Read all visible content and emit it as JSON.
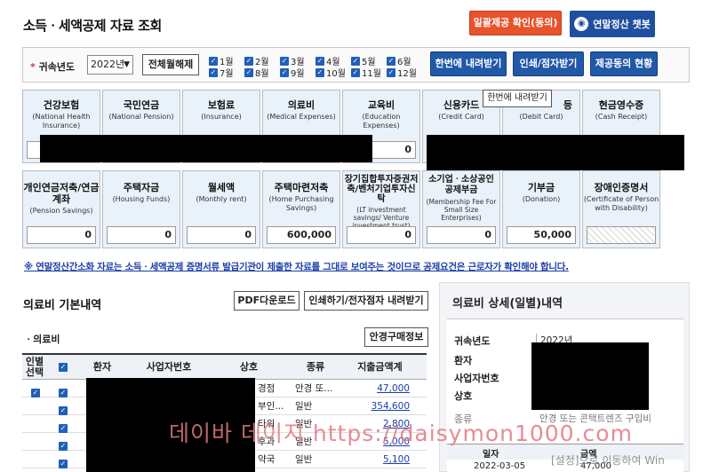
{
  "header": {
    "title": "소득ㆍ세액공제 자료 조회",
    "consent_button": "일괄제공 확인(동의)",
    "chatbot_button": "연말정산 챗봇"
  },
  "filter": {
    "year_label": "귀속년도",
    "year_value": "2022년",
    "clear_all": "전체월해제",
    "months": [
      "1월",
      "2월",
      "3월",
      "4월",
      "5월",
      "6월",
      "7월",
      "8월",
      "9월",
      "10월",
      "11월",
      "12월"
    ],
    "download_all": "한번에 내려받기",
    "print_submit": "인쇄/점자받기",
    "provision_status": "제공동의 현황"
  },
  "tooltip": "한번에 내려받기",
  "cards_row1": [
    {
      "kr": "건강보험",
      "en": "(National Health Insurance)",
      "value": ""
    },
    {
      "kr": "국민연금",
      "en": "(National Pension)",
      "value": ""
    },
    {
      "kr": "보험료",
      "en": "(Insurance)",
      "value": ""
    },
    {
      "kr": "의료비",
      "en": "(Medical Expenses)",
      "value": ""
    },
    {
      "kr": "교육비",
      "en": "(Education Expenses)",
      "value": "0"
    },
    {
      "kr": "신용카드",
      "en": "(Credit Card)",
      "value": ""
    },
    {
      "kr": "등",
      "en": "(Debit Card)",
      "value": ""
    },
    {
      "kr": "현금영수증",
      "en": "(Cash Receipt)",
      "value": ""
    }
  ],
  "cards_row2": [
    {
      "kr": "개인연금저축/연금계좌",
      "en": "(Pension Savings)",
      "value": "0"
    },
    {
      "kr": "주택자금",
      "en": "(Housing Funds)",
      "value": "0"
    },
    {
      "kr": "월세액",
      "en": "(Monthly rent)",
      "value": "0"
    },
    {
      "kr": "주택마련저축",
      "en": "(Home Purchasing Savings)",
      "value": "600,000"
    },
    {
      "kr": "장기집합투자증권저축/벤처기업투자신탁",
      "en": "(LT investment savings/ Venture investment trust)",
      "value": "0"
    },
    {
      "kr": "소기업ㆍ소상공인 공제부금",
      "en": "(Membership Fee For Small Size Enterprises)",
      "value": "0"
    },
    {
      "kr": "기부금",
      "en": "(Donation)",
      "value": "50,000"
    },
    {
      "kr": "장애인증명서",
      "en": "(Certificate of Person with Disability)",
      "value": ""
    }
  ],
  "notice": "※ 연말정산간소화 자료는 소득ㆍ세액공제 증명서류 발급기관이 제출한 자료를 그대로 보여주는 것이므로 공제요건은 근로자가 확인해야 합니다.",
  "medical": {
    "section_title": "의료비 기본내역",
    "pdf_button": "PDF다운로드",
    "print_button": "인쇄하기/전자점자 내려받기",
    "glasses_button": "안경구매정보",
    "sub_label": "의료비",
    "headers": [
      "인별 선택",
      "",
      "환자",
      "사업자번호",
      "상호",
      "종류",
      "지출금액계"
    ],
    "rows": [
      {
        "name_tail": "경점",
        "type": "안경 또...",
        "amount": "47,000"
      },
      {
        "name_tail": "부인...",
        "type": "일반",
        "amount": "354,600"
      },
      {
        "name_tail": "타워",
        "type": "일반",
        "amount": "2,800"
      },
      {
        "name_tail": "후과",
        "type": "일반",
        "amount": "5,000"
      },
      {
        "name_tail": "약국",
        "type": "일반",
        "amount": "5,100"
      }
    ]
  },
  "detail": {
    "section_title": "의료비 상세(일별)내역",
    "labels": [
      "귀속년도",
      "환자",
      "사업자번호",
      "상호",
      "종류"
    ],
    "year_value": "2022년",
    "type_value": "안경 또는 콘택트렌즈 구입비",
    "col_date": "일자",
    "col_amount": "금액",
    "row_date": "2022-03-05",
    "row_amount": "47,000"
  },
  "watermark": "데이바 데이지 https://daisymon1000.com",
  "windows_note": "[설정]으로 이동하여 Win"
}
